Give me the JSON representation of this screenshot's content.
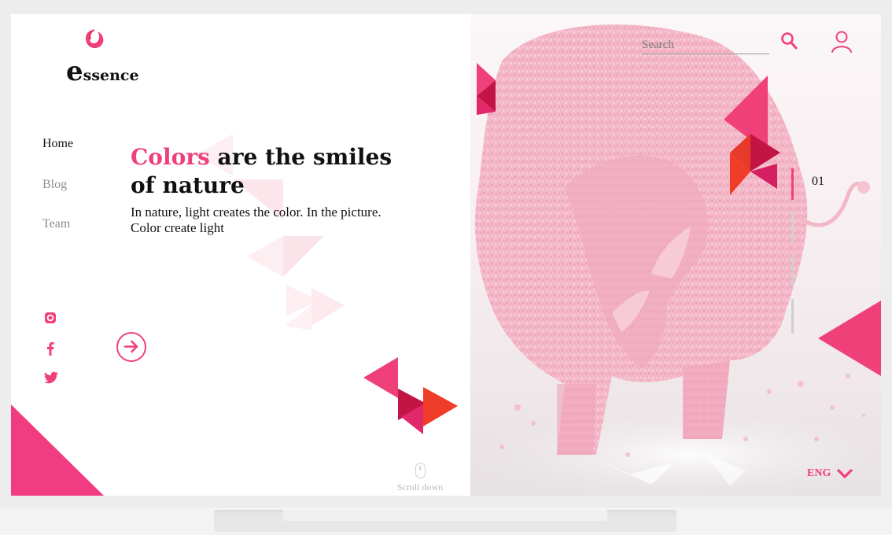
{
  "brand": {
    "logo_first_letter": "e",
    "logo_rest": "ssence",
    "accent_color": "#f0407a"
  },
  "nav": {
    "items": [
      {
        "label": "Home",
        "active": true
      },
      {
        "label": "Blog",
        "active": false
      },
      {
        "label": "Team",
        "active": false
      }
    ]
  },
  "hero": {
    "title_accent": "Colors",
    "title_rest_line1": " are the smiles",
    "title_line2": "of nature",
    "body_line1": "In nature, light creates the color. In the picture.",
    "body_line2": "Color create light"
  },
  "social": {
    "icons": [
      "instagram-icon",
      "facebook-icon",
      "twitter-icon"
    ]
  },
  "cta": {
    "icon": "arrow-right-circle-icon"
  },
  "scroll": {
    "label": "Scroll down",
    "icon": "mouse-icon"
  },
  "header": {
    "search_placeholder": "Search",
    "search_icon": "search-icon",
    "user_icon": "user-icon"
  },
  "slider": {
    "current": "01"
  },
  "language": {
    "label": "ENG",
    "icon": "chevron-down-icon"
  }
}
